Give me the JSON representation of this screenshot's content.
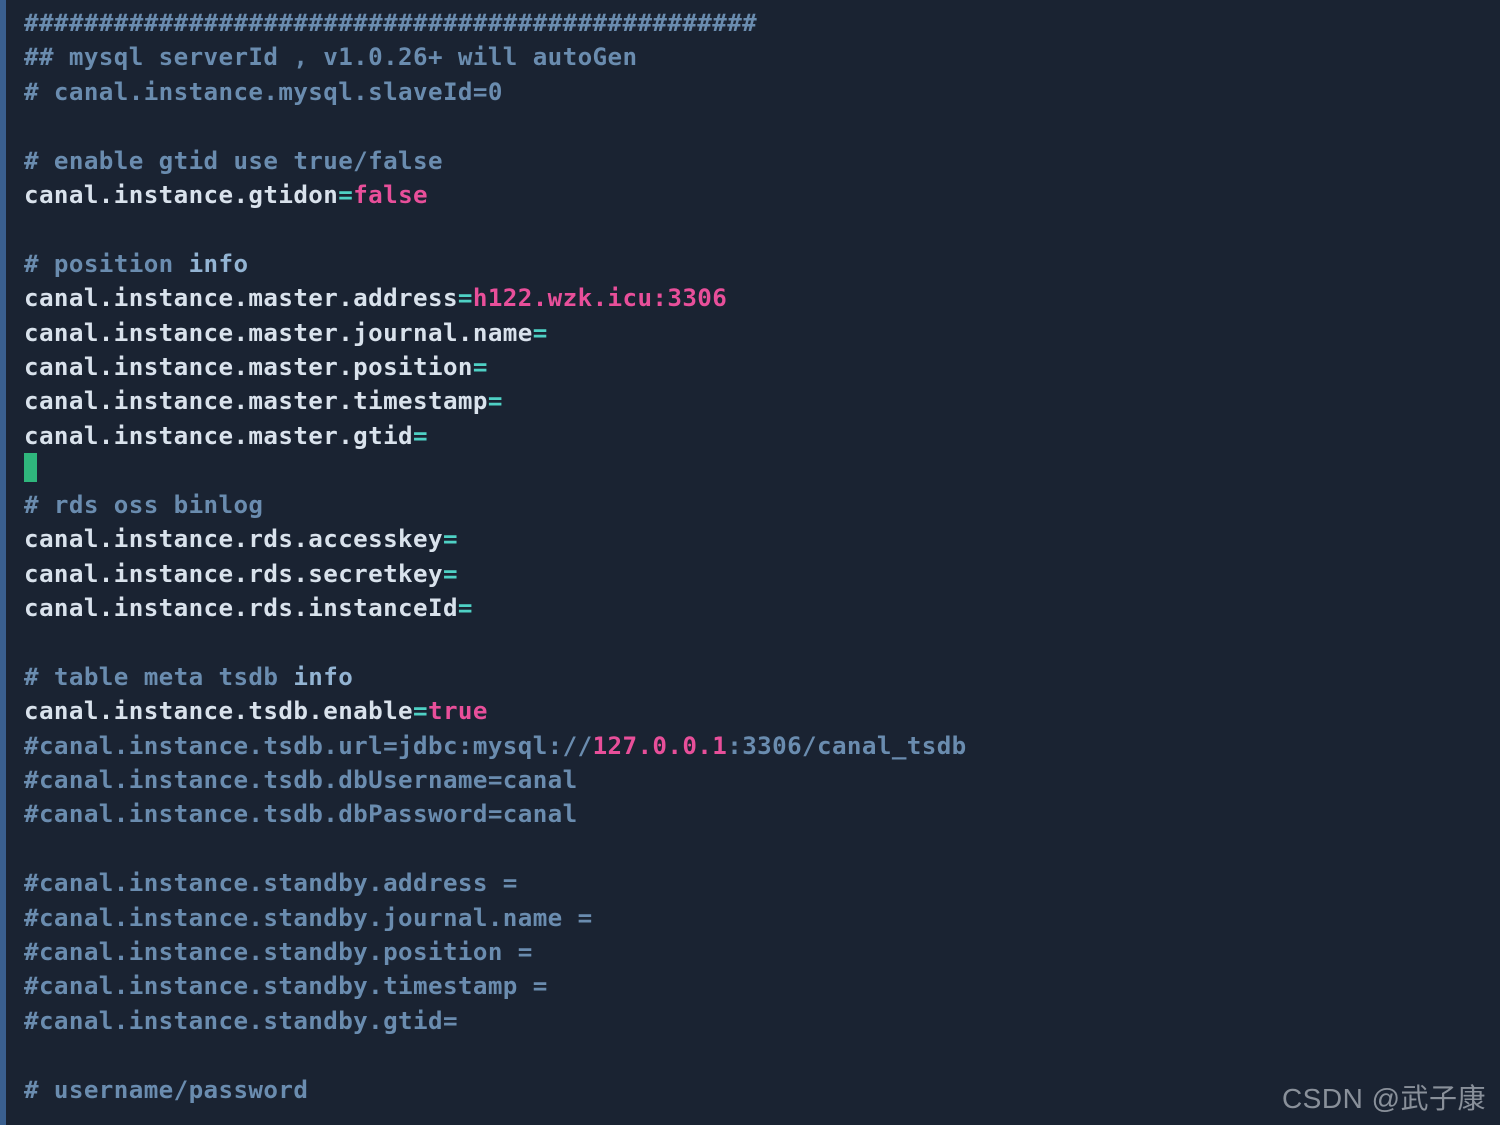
{
  "lines": {
    "l1": "#################################################",
    "l2": "## mysql serverId , v1.0.26+ will autoGen",
    "l3": "# canal.instance.mysql.slaveId=0",
    "l4_c": "# enable gtid use true/false",
    "k_gtidon": "canal.instance.gtidon",
    "v_gtidon": "false",
    "l_pos_c": "# position ",
    "l_pos_i": "info",
    "k_addr": "canal.instance.master.address",
    "v_addr": "h122.wzk.icu:3306",
    "k_jname": "canal.instance.master.journal.name",
    "k_mpos": "canal.instance.master.position",
    "k_mts": "canal.instance.master.timestamp",
    "k_mgtid": "canal.instance.master.gtid",
    "l_rds": "# rds oss binlog",
    "k_ak": "canal.instance.rds.accesskey",
    "k_sk": "canal.instance.rds.secretkey",
    "k_iid": "canal.instance.rds.instanceId",
    "l_tm_c": "# table meta tsdb ",
    "l_tm_i": "info",
    "k_tsdb": "canal.instance.tsdb.enable",
    "v_tsdb": "true",
    "l_url_a": "#canal.instance.tsdb.url=jdbc:mysql://",
    "l_url_ip": "127.0.0.1",
    "l_url_b": ":3306/canal_tsdb",
    "l_user": "#canal.instance.tsdb.dbUsername=canal",
    "l_pass": "#canal.instance.tsdb.dbPassword=canal",
    "l_sb1": "#canal.instance.standby.address =",
    "l_sb2": "#canal.instance.standby.journal.name =",
    "l_sb3": "#canal.instance.standby.position =",
    "l_sb4": "#canal.instance.standby.timestamp =",
    "l_sb5": "#canal.instance.standby.gtid=",
    "l_up": "# username/password"
  },
  "watermark": "CSDN @武子康"
}
